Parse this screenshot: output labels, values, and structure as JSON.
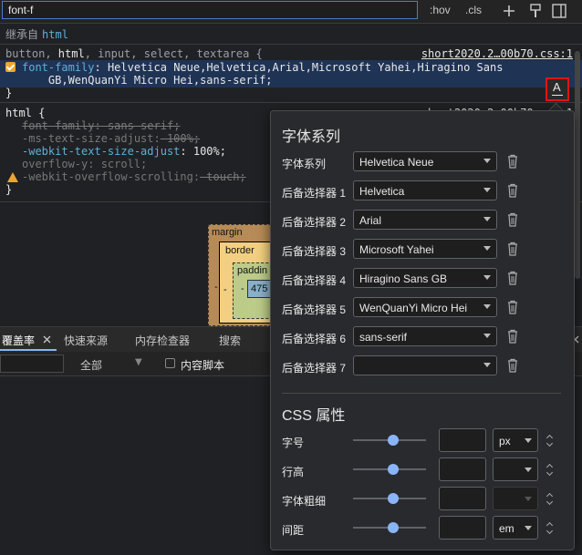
{
  "filter": {
    "value": "font-f"
  },
  "toolbar": {
    "hov": ":hov",
    "cls": ".cls"
  },
  "inherited": {
    "label": "继承自",
    "element": "html"
  },
  "rule1": {
    "selector_pre": "button, ",
    "selector_match": "html",
    "selector_post": ", input, select, textarea {",
    "source": "short2020.2…00b70.css:1",
    "prop": "font-family",
    "value_line1": " Helvetica Neue,Helvetica,Arial,Microsoft Yahei,Hiragino Sans",
    "value_line2": "    GB,WenQuanYi Micro Hei,sans-serif;",
    "close": "}"
  },
  "rule2": {
    "selector": "html {",
    "source": "short2020.2…00b70.css:1",
    "decls": [
      {
        "prop": "font-family",
        "value": " sans-serif;",
        "overridden": true
      },
      {
        "prop": "-ms-text-size-adjust",
        "value": " 100%;",
        "overridden": false,
        "invalid": true
      },
      {
        "prop": "-webkit-text-size-adjust",
        "value": " 100%;",
        "overridden": false
      },
      {
        "prop": "overflow-y",
        "value": " scroll;",
        "overridden": false,
        "dim": true
      },
      {
        "prop": "-webkit-overflow-scrolling",
        "value": " touch;",
        "overridden": false,
        "warn": true
      }
    ],
    "close": "}"
  },
  "boxmodel": {
    "margin": "margin",
    "border": "border",
    "padding": "paddin",
    "content": "475",
    "dash": "-"
  },
  "drawer": {
    "tabs": [
      "覆盖率",
      "快速来源",
      "内存检查器",
      "搜索"
    ],
    "filter_select": "全部",
    "content_scripts": "内容脚本"
  },
  "font_editor": {
    "font_section_title": "字体系列",
    "rows": [
      {
        "label": "字体系列",
        "value": "Helvetica Neue"
      },
      {
        "label": "后备选择器 1",
        "value": "Helvetica"
      },
      {
        "label": "后备选择器 2",
        "value": "Arial"
      },
      {
        "label": "后备选择器 3",
        "value": "Microsoft Yahei"
      },
      {
        "label": "后备选择器 4",
        "value": "Hiragino Sans GB"
      },
      {
        "label": "后备选择器 5",
        "value": "WenQuanYi Micro Hei"
      },
      {
        "label": "后备选择器 6",
        "value": "sans-serif"
      },
      {
        "label": "后备选择器 7",
        "value": ""
      }
    ],
    "css_section_title": "CSS 属性",
    "props": [
      {
        "label": "字号",
        "unit": "px",
        "disabled": false
      },
      {
        "label": "行高",
        "unit": "",
        "disabled": false
      },
      {
        "label": "字体粗细",
        "unit": "",
        "disabled": true
      },
      {
        "label": "间距",
        "unit": "em",
        "disabled": false
      }
    ]
  },
  "colors": {
    "accent": "#8ab4f8",
    "highlight_border": "#e01515",
    "checkbox": "#f0a430"
  }
}
